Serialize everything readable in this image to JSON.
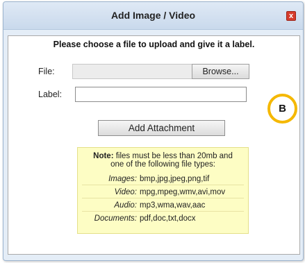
{
  "dialog": {
    "title": "Add Image / Video",
    "close_glyph": "x",
    "close_icon": "close-icon",
    "instructions": "Please choose a file to upload and give it a label.",
    "file_label": "File:",
    "browse_label": "Browse...",
    "label_label": "Label:",
    "label_value": "",
    "add_button_label": "Add Attachment"
  },
  "badge": {
    "text": "B",
    "ring_color": "#f5b800"
  },
  "note": {
    "prefix": "Note:",
    "line1": " files must be less than 20mb and",
    "line2": "one of the following file types:",
    "file_types": [
      {
        "name": "Images:",
        "list": "bmp,jpg,jpeg,png,tif"
      },
      {
        "name": "Video:",
        "list": "mpg,mpeg,wmv,avi,mov"
      },
      {
        "name": "Audio:",
        "list": "mp3,wma,wav,aac"
      },
      {
        "name": "Documents:",
        "list": "pdf,doc,txt,docx"
      }
    ],
    "background": "#fdfdc4"
  }
}
